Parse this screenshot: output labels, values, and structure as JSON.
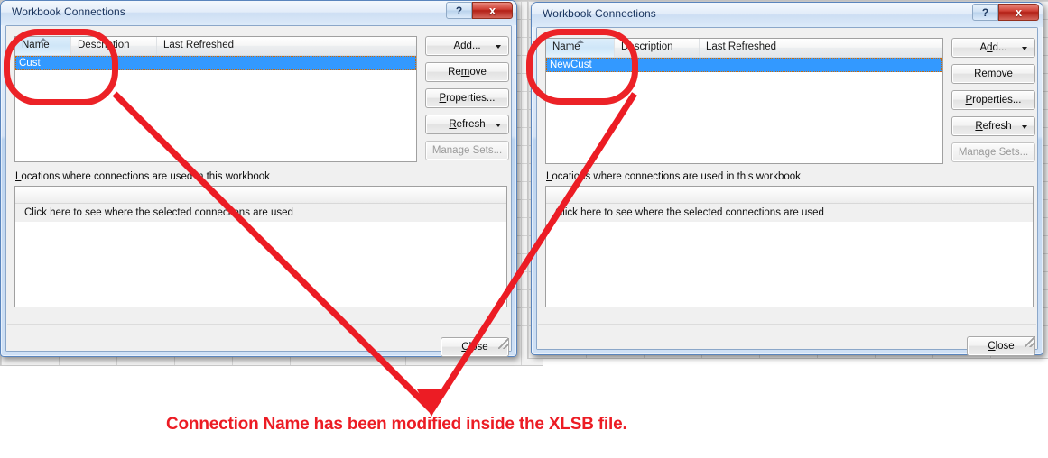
{
  "dialogs": [
    {
      "id": "left",
      "title": "Workbook Connections",
      "caption_help": "?",
      "caption_close": "x",
      "columns": [
        "Name",
        "Description",
        "Last Refreshed"
      ],
      "rows": [
        {
          "name": "Cust",
          "description": "",
          "last_refreshed": ""
        }
      ],
      "buttons": {
        "add": "Add...",
        "remove": "Remove",
        "properties": "Properties...",
        "refresh": "Refresh",
        "manage_sets": "Manage Sets..."
      },
      "locations_label": "Locations where connections are used in this workbook",
      "locations_row": "Click here to see where the selected connections are used",
      "close_button": "Close"
    },
    {
      "id": "right",
      "title": "Workbook Connections",
      "caption_help": "?",
      "caption_close": "x",
      "columns": [
        "Name",
        "Description",
        "Last Refreshed"
      ],
      "rows": [
        {
          "name": "NewCust",
          "description": "",
          "last_refreshed": ""
        }
      ],
      "buttons": {
        "add": "Add...",
        "remove": "Remove",
        "properties": "Properties...",
        "refresh": "Refresh",
        "manage_sets": "Manage Sets..."
      },
      "locations_label": "Locations where connections are used in this workbook",
      "locations_row": "Click here to see where the selected connections are used",
      "close_button": "Close"
    }
  ],
  "annotation": {
    "caption": "Connection Name has been modified inside the XLSB file.",
    "color": "#ec1c24",
    "highlight_shape": "rounded-rectangle",
    "arrow_style": "v-shaped-pointer"
  },
  "colors": {
    "accent_selection": "#3399ff",
    "annotation_red": "#ec1c24",
    "title_text": "#17325c",
    "dialog_face": "#f0f0f0"
  }
}
